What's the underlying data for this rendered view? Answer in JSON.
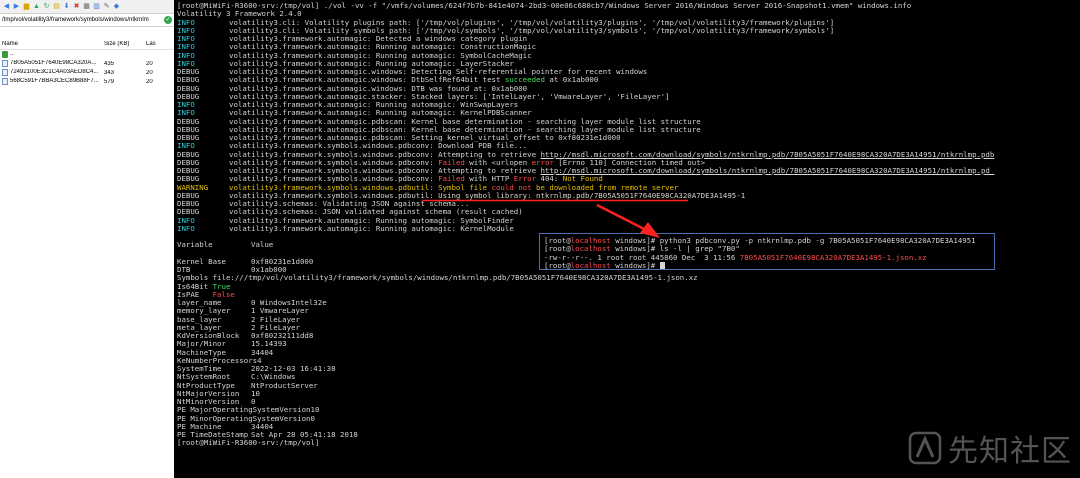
{
  "file_manager": {
    "path": "/tmp/vol/volatility3/framework/symbols/windows/ntkrnlm",
    "columns": [
      "Name",
      "Size (KB)",
      "Las"
    ],
    "parent_label": "..",
    "files": [
      {
        "name": "7B05A5051F7640E98CA320A...",
        "size": "435",
        "last": "20"
      },
      {
        "name": "72492100E3C1C4A03AED8C4...",
        "size": "343",
        "last": "20"
      },
      {
        "name": "568C591F7BBA3CEC89B88F7...",
        "size": "579",
        "last": "20"
      }
    ]
  },
  "terminal": {
    "lines": [
      {
        "parts": [
          {
            "t": "[root@MiWiFi-R3600-srv:/tmp/vol] ./vol -vv -f \"/vmfs/volumes/624f7b7b-841e4074-2bd3-00e06c680cb7/Windows Server 2016/Windows Server 2016-Snapshot1.vmem\" windows.info",
            "c": ""
          }
        ]
      },
      {
        "parts": [
          {
            "t": "Volatility 3 Framework 2.4.0",
            "c": ""
          }
        ]
      },
      {
        "level": "INFO",
        "parts": [
          {
            "t": "volatility3.cli: Volatility plugins path: ['/tmp/vol/plugins', '/tmp/vol/volatility3/plugins', '/tmp/vol/volatility3/framework/plugins']",
            "c": ""
          }
        ]
      },
      {
        "level": "INFO",
        "parts": [
          {
            "t": "volatility3.cli: Volatility symbols path: ['/tmp/vol/symbols', '/tmp/vol/volatility3/symbols', '/tmp/vol/volatility3/framework/symbols']",
            "c": ""
          }
        ]
      },
      {
        "level": "INFO",
        "parts": [
          {
            "t": "volatility3.framework.automagic: Detected a windows category plugin",
            "c": ""
          }
        ]
      },
      {
        "level": "INFO",
        "parts": [
          {
            "t": "volatility3.framework.automagic: Running automagic: ConstructionMagic",
            "c": ""
          }
        ]
      },
      {
        "level": "INFO",
        "parts": [
          {
            "t": "volatility3.framework.automagic: Running automagic: SymbolCacheMagic",
            "c": ""
          }
        ]
      },
      {
        "level": "INFO",
        "parts": [
          {
            "t": "volatility3.framework.automagic: Running automagic: LayerStacker",
            "c": ""
          }
        ]
      },
      {
        "level": "DEBUG",
        "parts": [
          {
            "t": "volatility3.framework.automagic.windows: Detecting Self-referential pointer for recent windows",
            "c": ""
          }
        ]
      },
      {
        "level": "DEBUG",
        "parts": [
          {
            "t": "volatility3.framework.automagic.windows: DtbSelfRef64bit test ",
            "c": ""
          },
          {
            "t": "succeeded",
            "c": "green"
          },
          {
            "t": " at 0x1ab000",
            "c": ""
          }
        ]
      },
      {
        "level": "DEBUG",
        "parts": [
          {
            "t": "volatility3.framework.automagic.windows: DTB was found at: 0x1ab000",
            "c": ""
          }
        ]
      },
      {
        "level": "DEBUG",
        "parts": [
          {
            "t": "volatility3.framework.automagic.stacker: Stacked layers: ['IntelLayer', 'VmwareLayer', 'FileLayer']",
            "c": ""
          }
        ]
      },
      {
        "level": "INFO",
        "parts": [
          {
            "t": "volatility3.framework.automagic: Running automagic: WinSwapLayers",
            "c": ""
          }
        ]
      },
      {
        "level": "INFO",
        "parts": [
          {
            "t": "volatility3.framework.automagic: Running automagic: KernelPDBScanner",
            "c": ""
          }
        ]
      },
      {
        "level": "DEBUG",
        "parts": [
          {
            "t": "volatility3.framework.automagic.pdbscan: Kernel base determination - searching layer module list structure",
            "c": ""
          }
        ]
      },
      {
        "level": "DEBUG",
        "parts": [
          {
            "t": "volatility3.framework.automagic.pdbscan: Kernel base determination - searching layer module list structure",
            "c": ""
          }
        ]
      },
      {
        "level": "DEBUG",
        "parts": [
          {
            "t": "volatility3.framework.automagic.pdbscan: Setting kernel_virtual_offset to 0xf80231e1d000",
            "c": ""
          }
        ]
      },
      {
        "level": "INFO",
        "parts": [
          {
            "t": "volatility3.framework.symbols.windows.pdbconv: Download PDB file...",
            "c": ""
          }
        ]
      },
      {
        "level": "DEBUG",
        "parts": [
          {
            "t": "volatility3.framework.symbols.windows.pdbconv: Attempting to retrieve ",
            "c": ""
          },
          {
            "t": "http://msdl.microsoft.com/download/symbols/ntkrnlmp.pdb/7B05A5051F7640E98CA320A7DE3A14951/ntkrnlmp.pdb",
            "c": "url"
          }
        ]
      },
      {
        "level": "DEBUG",
        "parts": [
          {
            "t": "volatility3.framework.symbols.windows.pdbconv: ",
            "c": ""
          },
          {
            "t": "Failed",
            "c": "red"
          },
          {
            "t": " with <urlopen ",
            "c": ""
          },
          {
            "t": "error",
            "c": "red"
          },
          {
            "t": " [Errno 110] Connection timed out>",
            "c": ""
          }
        ]
      },
      {
        "level": "DEBUG",
        "parts": [
          {
            "t": "volatility3.framework.symbols.windows.pdbconv: Attempting to retrieve ",
            "c": ""
          },
          {
            "t": "http://msdl.microsoft.com/download/symbols/ntkrnlmp.pdb/7B05A5051F7640E98CA320A7DE3A14951/ntkrnlmp.pd_",
            "c": "url"
          }
        ]
      },
      {
        "level": "DEBUG",
        "parts": [
          {
            "t": "volatility3.framework.symbols.windows.pdbconv: ",
            "c": ""
          },
          {
            "t": "Failed",
            "c": "red"
          },
          {
            "t": " with HTTP ",
            "c": ""
          },
          {
            "t": "Error",
            "c": "red"
          },
          {
            "t": " 404: ",
            "c": ""
          },
          {
            "t": "Not Found",
            "c": "yellow"
          }
        ]
      },
      {
        "level": "WARNING",
        "parts": [
          {
            "t": "volatility3.framework.symbols.windows.pdbutil: Symbol file ",
            "c": "yellow"
          },
          {
            "t": "could not",
            "c": "red"
          },
          {
            "t": " be downloaded from remote server",
            "c": "yellow"
          }
        ]
      },
      {
        "level": "DEBUG",
        "parts": [
          {
            "t": "volatility3.framework.symbols.windows.pdbutil: Using symbol library: ntkrnlmp.pdb/7B05A5051F7640E98CA320A7DE3A1495-1",
            "c": ""
          }
        ]
      },
      {
        "level": "DEBUG",
        "parts": [
          {
            "t": "volatility3.schemas: Validating JSON against schema...",
            "c": ""
          }
        ]
      },
      {
        "level": "DEBUG",
        "parts": [
          {
            "t": "volatility3.schemas: JSON validated against schema (result cached)",
            "c": ""
          }
        ]
      },
      {
        "level": "INFO",
        "parts": [
          {
            "t": "volatility3.framework.automagic: Running automagic: SymbolFinder",
            "c": ""
          }
        ]
      },
      {
        "level": "INFO",
        "parts": [
          {
            "t": "volatility3.framework.automagic: Running automagic: KernelModule",
            "c": ""
          }
        ]
      },
      {
        "parts": [
          {
            "t": "",
            "c": ""
          }
        ]
      },
      {
        "parts": [
          {
            "t": "Variable\tValue",
            "c": ""
          }
        ]
      },
      {
        "parts": [
          {
            "t": "",
            "c": ""
          }
        ]
      },
      {
        "parts": [
          {
            "t": "Kernel Base\t0xf80231e1d000",
            "c": ""
          }
        ]
      },
      {
        "parts": [
          {
            "t": "DTB\t0x1ab000",
            "c": ""
          }
        ]
      },
      {
        "parts": [
          {
            "t": "Symbols file:///tmp/vol/volatility3/framework/symbols/windows/ntkrnlmp.pdb/7B05A5051F7640E98CA320A7DE3A1495-1.json.xz",
            "c": ""
          }
        ]
      },
      {
        "parts": [
          {
            "t": "Is64Bit ",
            "c": ""
          },
          {
            "t": "True",
            "c": "green"
          }
        ]
      },
      {
        "parts": [
          {
            "t": "IsPAE   ",
            "c": ""
          },
          {
            "t": "False",
            "c": "red"
          }
        ]
      },
      {
        "parts": [
          {
            "t": "layer_name\t0 WindowsIntel32e",
            "c": ""
          }
        ]
      },
      {
        "parts": [
          {
            "t": "memory_layer\t1 VmwareLayer",
            "c": ""
          }
        ]
      },
      {
        "parts": [
          {
            "t": "base_layer\t2 FileLayer",
            "c": ""
          }
        ]
      },
      {
        "parts": [
          {
            "t": "meta_layer\t2 FileLayer",
            "c": ""
          }
        ]
      },
      {
        "parts": [
          {
            "t": "KdVersionBlock\t0xf80232111dd8",
            "c": ""
          }
        ]
      },
      {
        "parts": [
          {
            "t": "Major/Minor\t15.14393",
            "c": ""
          }
        ]
      },
      {
        "parts": [
          {
            "t": "MachineType\t34404",
            "c": ""
          }
        ]
      },
      {
        "parts": [
          {
            "t": "KeNumberProcessors\t4",
            "c": ""
          }
        ]
      },
      {
        "parts": [
          {
            "t": "SystemTime\t2022-12-03 16:41:38",
            "c": ""
          }
        ]
      },
      {
        "parts": [
          {
            "t": "NtSystemRoot\tC:\\Windows",
            "c": ""
          }
        ]
      },
      {
        "parts": [
          {
            "t": "NtProductType\tNtProductServer",
            "c": ""
          }
        ]
      },
      {
        "parts": [
          {
            "t": "NtMajorVersion\t10",
            "c": ""
          }
        ]
      },
      {
        "parts": [
          {
            "t": "NtMinorVersion\t0",
            "c": ""
          }
        ]
      },
      {
        "parts": [
          {
            "t": "PE MajorOperatingSystemVersion\t10",
            "c": ""
          }
        ]
      },
      {
        "parts": [
          {
            "t": "PE MinorOperatingSystemVersion\t0",
            "c": ""
          }
        ]
      },
      {
        "parts": [
          {
            "t": "PE Machine\t34404",
            "c": ""
          }
        ]
      },
      {
        "parts": [
          {
            "t": "PE TimeDateStamp\tSat Apr 28 05:41:18 2018",
            "c": ""
          }
        ]
      },
      {
        "parts": [
          {
            "t": "[root@MiWiFi-R3600-srv:/tmp/vol]",
            "c": ""
          }
        ]
      }
    ]
  },
  "overlay": {
    "lines": [
      {
        "parts": [
          {
            "t": "[root@",
            "c": ""
          },
          {
            "t": "localhost",
            "c": "host"
          },
          {
            "t": " windows]# python3 pdbconv.py -p ntkrnlmp.pdb -g 7B05A5051F7640E98CA320A7DE3A14951",
            "c": ""
          }
        ]
      },
      {
        "parts": [
          {
            "t": "[root@",
            "c": ""
          },
          {
            "t": "localhost",
            "c": "host"
          },
          {
            "t": " windows]# ls -l | grep \"7B0\"",
            "c": ""
          }
        ]
      },
      {
        "parts": [
          {
            "t": "-rw-r--r--. 1 root root 445860 Dec  3 11:56 ",
            "c": ""
          },
          {
            "t": "7B05A5051F7640E98CA320A7DE3A1495-1.json.xz",
            "c": "fname"
          }
        ]
      },
      {
        "parts": [
          {
            "t": "[root@",
            "c": ""
          },
          {
            "t": "localhost",
            "c": "host"
          },
          {
            "t": " windows]# ",
            "c": ""
          }
        ],
        "cursor": true
      }
    ]
  },
  "watermark": {
    "text": "先知社区"
  },
  "colors": {
    "info": "#2ecfdc",
    "warning": "#e6c100",
    "error": "#ff4b4b",
    "success": "#3edc5a",
    "annotation": "#ff2020"
  }
}
